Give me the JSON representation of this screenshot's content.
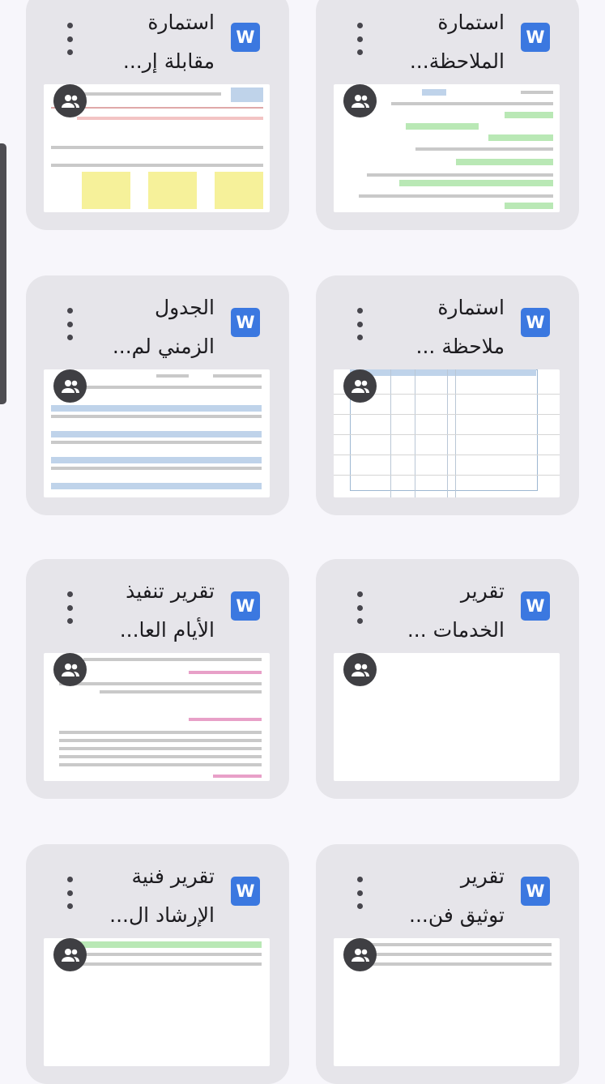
{
  "cards": [
    {
      "title_line1": "استمارة",
      "title_line2": "الملاحظة...",
      "file_type": "word-icon",
      "icon_letter": "W",
      "shared": true
    },
    {
      "title_line1": "استمارة",
      "title_line2": "مقابلة إر...",
      "file_type": "word-icon",
      "icon_letter": "W",
      "shared": true
    },
    {
      "title_line1": "استمارة",
      "title_line2": "ملاحظة ...",
      "file_type": "word-icon",
      "icon_letter": "W",
      "shared": true
    },
    {
      "title_line1": "الجدول",
      "title_line2": "الزمني لم...",
      "file_type": "word-icon",
      "icon_letter": "W",
      "shared": true
    },
    {
      "title_line1": "تقرير",
      "title_line2": "الخدمات ...",
      "file_type": "word-icon",
      "icon_letter": "W",
      "shared": true
    },
    {
      "title_line1": "تقرير تنفيذ",
      "title_line2": "الأيام العا...",
      "file_type": "word-icon",
      "icon_letter": "W",
      "shared": true
    },
    {
      "title_line1": "تقرير",
      "title_line2": "توثيق فن...",
      "file_type": "word-icon",
      "icon_letter": "W",
      "shared": true
    },
    {
      "title_line1": "تقرير فنية",
      "title_line2": "الإرشاد ال...",
      "file_type": "word-icon",
      "icon_letter": "W",
      "shared": true
    }
  ],
  "colors": {
    "word_icon": "#3b78e0",
    "card_bg": "#e6e5ea",
    "page_bg": "#f7f6fb"
  }
}
